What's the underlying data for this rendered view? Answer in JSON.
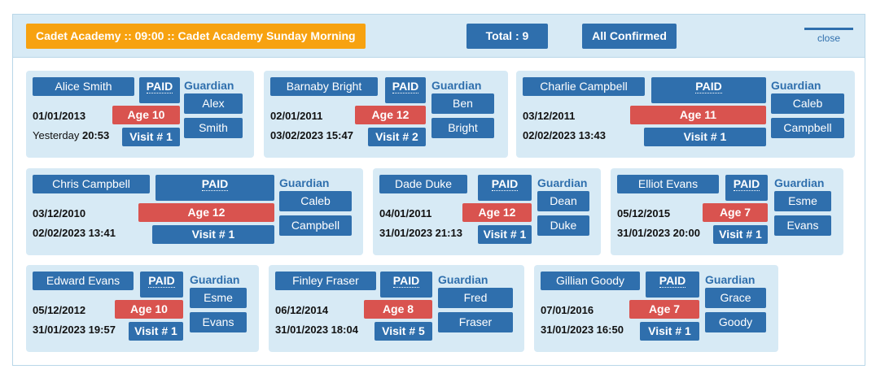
{
  "header": {
    "title": "Cadet Academy :: 09:00 :: Cadet Academy Sunday Morning",
    "total_label": "Total : 9",
    "status_label": "All Confirmed",
    "close_label": "close"
  },
  "colors": {
    "accent_orange": "#f7a210",
    "primary_blue": "#2f6fad",
    "age_red": "#d9534f",
    "card_bg": "#d7eaf5"
  },
  "cards": [
    {
      "name": "Alice Smith",
      "paid": "PAID",
      "guardian_label": "Guardian",
      "guardian_first": "Alex",
      "guardian_last": "Smith",
      "dob": "01/01/2013",
      "age": "Age 10",
      "visit_date_prefix": "Yesterday",
      "visit_date": "20:53",
      "visit": "Visit # 1"
    },
    {
      "name": "Barnaby Bright",
      "paid": "PAID",
      "guardian_label": "Guardian",
      "guardian_first": "Ben",
      "guardian_last": "Bright",
      "dob": "02/01/2011",
      "age": "Age 12",
      "visit_date": "03/02/2023 15:47",
      "visit": "Visit # 2"
    },
    {
      "name": "Charlie Campbell",
      "paid": "PAID",
      "guardian_label": "Guardian",
      "guardian_first": "Caleb",
      "guardian_last": "Campbell",
      "dob": "03/12/2011",
      "age": "Age 11",
      "visit_date": "02/02/2023 13:43",
      "visit": "Visit # 1"
    },
    {
      "name": "Chris Campbell",
      "paid": "PAID",
      "guardian_label": "Guardian",
      "guardian_first": "Caleb",
      "guardian_last": "Campbell",
      "dob": "03/12/2010",
      "age": "Age 12",
      "visit_date": "02/02/2023 13:41",
      "visit": "Visit # 1"
    },
    {
      "name": "Dade Duke",
      "paid": "PAID",
      "guardian_label": "Guardian",
      "guardian_first": "Dean",
      "guardian_last": "Duke",
      "dob": "04/01/2011",
      "age": "Age 12",
      "visit_date": "31/01/2023 21:13",
      "visit": "Visit # 1"
    },
    {
      "name": "Elliot Evans",
      "paid": "PAID",
      "guardian_label": "Guardian",
      "guardian_first": "Esme",
      "guardian_last": "Evans",
      "dob": "05/12/2015",
      "age": "Age 7",
      "visit_date": "31/01/2023 20:00",
      "visit": "Visit # 1"
    },
    {
      "name": "Edward Evans",
      "paid": "PAID",
      "guardian_label": "Guardian",
      "guardian_first": "Esme",
      "guardian_last": "Evans",
      "dob": "05/12/2012",
      "age": "Age 10",
      "visit_date": "31/01/2023 19:57",
      "visit": "Visit # 1"
    },
    {
      "name": "Finley Fraser",
      "paid": "PAID",
      "guardian_label": "Guardian",
      "guardian_first": "Fred",
      "guardian_last": "Fraser",
      "dob": "06/12/2014",
      "age": "Age 8",
      "visit_date": "31/01/2023 18:04",
      "visit": "Visit # 5"
    },
    {
      "name": "Gillian Goody",
      "paid": "PAID",
      "guardian_label": "Guardian",
      "guardian_first": "Grace",
      "guardian_last": "Goody",
      "dob": "07/01/2016",
      "age": "Age 7",
      "visit_date": "31/01/2023 16:50",
      "visit": "Visit # 1"
    }
  ]
}
